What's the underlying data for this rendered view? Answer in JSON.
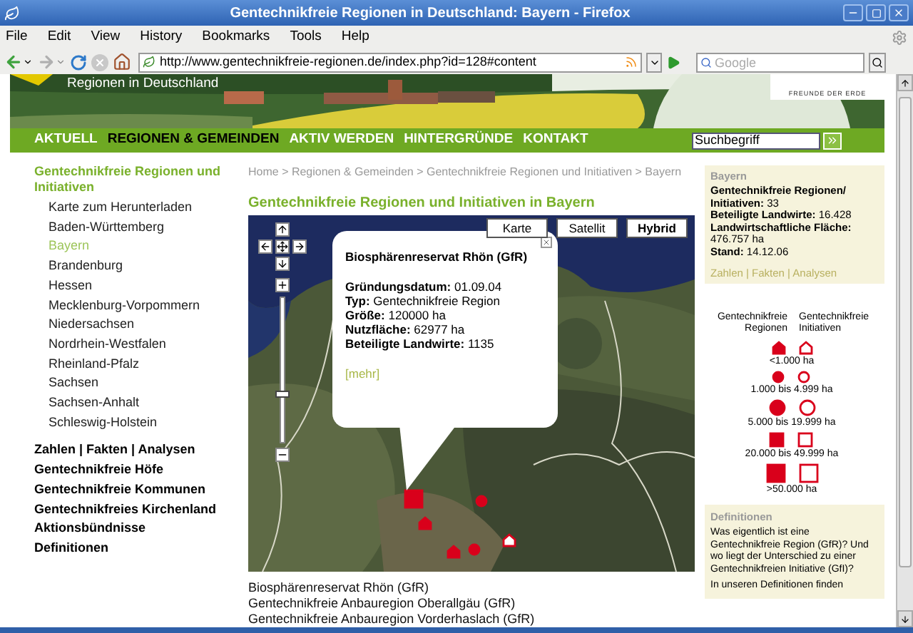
{
  "window": {
    "title": "Gentechnikfreie Regionen in Deutschland: Bayern - Firefox"
  },
  "menu": [
    "File",
    "Edit",
    "View",
    "History",
    "Bookmarks",
    "Tools",
    "Help"
  ],
  "address_bar": {
    "value": "http://www.gentechnikfreie-regionen.de/index.php?id=128#content"
  },
  "search_bar": {
    "placeholder": "Google"
  },
  "header": {
    "site_subtitle": "Regionen in Deutschland",
    "logo_tagline": "FREUNDE DER ERDE"
  },
  "nav": {
    "items": [
      {
        "label": "AKTUELL",
        "selected": false
      },
      {
        "label": "REGIONEN & GEMEINDEN",
        "selected": true
      },
      {
        "label": "AKTIV WERDEN",
        "selected": false
      },
      {
        "label": "HINTERGRÜNDE",
        "selected": false
      },
      {
        "label": "KONTAKT",
        "selected": false
      }
    ],
    "search": {
      "value": "Suchbegriff"
    }
  },
  "sidebar": {
    "heading": "Gentechnikfreie Regionen und Initiativen",
    "items": [
      {
        "label": "Karte zum Herunterladen",
        "selected": false
      },
      {
        "label": "Baden-Württemberg",
        "selected": false
      },
      {
        "label": "Bayern",
        "selected": true
      },
      {
        "label": "Brandenburg",
        "selected": false
      },
      {
        "label": "Hessen",
        "selected": false
      },
      {
        "label": "Mecklenburg-Vorpommern",
        "selected": false
      },
      {
        "label": "Niedersachsen",
        "selected": false
      },
      {
        "label": "Nordrhein-Westfalen",
        "selected": false
      },
      {
        "label": "Rheinland-Pfalz",
        "selected": false
      },
      {
        "label": "Sachsen",
        "selected": false
      },
      {
        "label": "Sachsen-Anhalt",
        "selected": false
      },
      {
        "label": "Schleswig-Holstein",
        "selected": false
      }
    ],
    "links": [
      "Zahlen | Fakten | Analysen",
      "Gentechnikfreie Höfe",
      "Gentechnikfreie Kommunen",
      "Gentechnikfreies Kirchenland",
      "Aktionsbündnisse",
      "Definitionen"
    ]
  },
  "breadcrumb": "Home > Regionen & Gemeinden > Gentechnikfreie Regionen und Initiativen > Bayern",
  "page_title": "Gentechnikfreie Regionen und Initiativen in Bayern",
  "map": {
    "map_types": [
      {
        "label": "Karte",
        "selected": false
      },
      {
        "label": "Satellit",
        "selected": false
      },
      {
        "label": "Hybrid",
        "selected": true
      }
    ],
    "zoom": {
      "level": 0.34
    },
    "info_window": {
      "title": "Biosphärenreservat Rhön (GfR)",
      "fields": [
        "**Gründungsdatum:** 01.09.04",
        "**Typ:** Gentechnikfreie Region",
        "**Größe:** 120000 ha",
        "**Nutzfläche:** 62977 ha",
        "**Beteiligte Landwirte:** 1135"
      ],
      "link": "[mehr]"
    }
  },
  "results": [
    "Biosphärenreservat Rhön (GfR)",
    "Gentechnikfreie Anbauregion Oberallgäu (GfR)",
    "Gentechnikfreie Anbauregion Vorderhaslach (GfR)"
  ],
  "stats": {
    "heading": "Bayern",
    "lines": [
      "**Gentechnikfreie Regionen/ Initiativen:** 33",
      "**Beteiligte Landwirte:** 16.428",
      "**Landwirtschaftliche Fläche:** 476.757 ha",
      "**Stand:** 14.12.06"
    ],
    "link": "Zahlen | Fakten | Analysen"
  },
  "legend": {
    "columns": [
      "Gentechnikfreie Regionen",
      "Gentechnikfreie Initiativen"
    ],
    "rows": [
      {
        "kind": "house",
        "label": "<1.000 ha"
      },
      {
        "kind": "circle",
        "label": "1.000 bis 4.999 ha"
      },
      {
        "kind": "bigcircle",
        "label": "5.000 bis 19.999 ha"
      },
      {
        "kind": "square",
        "label": "20.000 bis 49.999 ha"
      },
      {
        "kind": "bigsquare",
        "label": ">50.000 ha"
      }
    ]
  },
  "definitions": {
    "heading": "Definitionen",
    "paragraphs": [
      "Was eigentlich ist eine Gentechnikfreie Region (GfR)? Und wo liegt der Unterschied zu einer Gentechnikfreien Initiative (GfI)?",
      "In unseren Definitionen finden"
    ]
  }
}
